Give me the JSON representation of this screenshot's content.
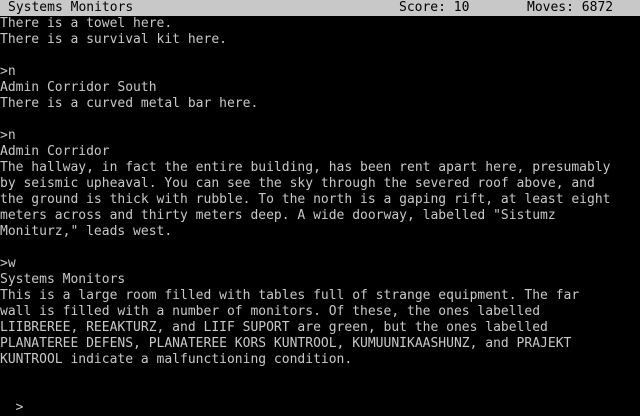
{
  "status": {
    "location": "Systems Monitors",
    "score_label": "Score: 10",
    "moves_label": "Moves: 6872"
  },
  "transcript": [
    "There is a towel here.",
    "There is a survival kit here.",
    "",
    ">n",
    "Admin Corridor South",
    "There is a curved metal bar here.",
    "",
    ">n",
    "Admin Corridor",
    "The hallway, in fact the entire building, has been rent apart here, presumably",
    "by seismic upheaval. You can see the sky through the severed roof above, and",
    "the ground is thick with rubble. To the north is a gaping rift, at least eight",
    "meters across and thirty meters deep. A wide doorway, labelled \"Sistumz",
    "Moniturz,\" leads west.",
    "",
    ">w",
    "Systems Monitors",
    "This is a large room filled with tables full of strange equipment. The far",
    "wall is filled with a number of monitors. Of these, the ones labelled",
    "LIIBREREE, REEAKTURZ, and LIIF SUPORT are green, but the ones labelled",
    "PLANATEREE DEFENS, PLANATEREE KORS KUNTROOL, KUMUUNIKAASHUNZ, and PRAJEKT",
    "KUNTROOL indicate a malfunctioning condition.",
    ""
  ],
  "prompt": {
    "symbol": ">",
    "value": ""
  }
}
